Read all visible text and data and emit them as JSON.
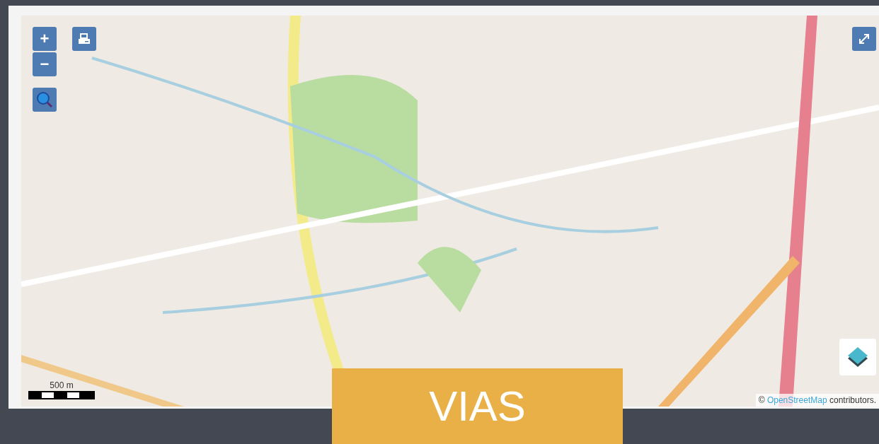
{
  "map": {
    "zoom_in": "+",
    "zoom_out": "−",
    "scale": "500 m",
    "attribution": {
      "prefix": "©",
      "link": "OpenStreetMap",
      "suffix": "contributors."
    }
  },
  "banner": {
    "title": "VIAS"
  }
}
